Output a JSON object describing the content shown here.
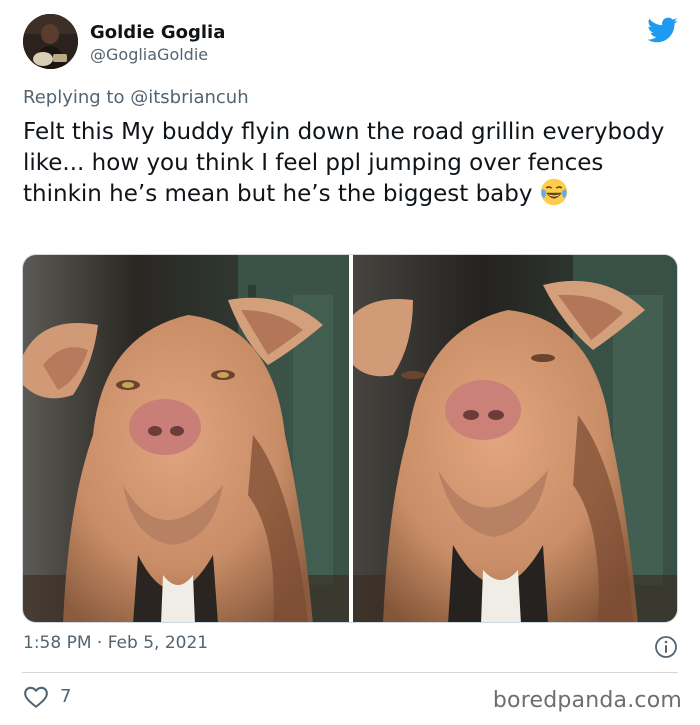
{
  "author": {
    "name": "Goldie Goglia",
    "handle": "@GogliaGoldie"
  },
  "reply": {
    "prefix": "Replying to ",
    "mention": "@itsbriancuh"
  },
  "tweet": {
    "text": "Felt this My buddy flyin down the road grillin everybody like... how you think I feel ppl jumping over fences thinkin he’s mean but he’s the biggest baby ",
    "emoji": "face-with-tears-of-joy"
  },
  "meta": {
    "timestamp": "1:58 PM · Feb 5, 2021"
  },
  "stats": {
    "likes": "7"
  },
  "watermark": "boredpanda.com",
  "colors": {
    "twitter_blue": "#1d9bf0",
    "text_primary": "#0f1419",
    "text_secondary": "#536471"
  },
  "icons": {
    "brand": "twitter-bird-icon",
    "info": "info-icon",
    "like": "heart-icon"
  }
}
